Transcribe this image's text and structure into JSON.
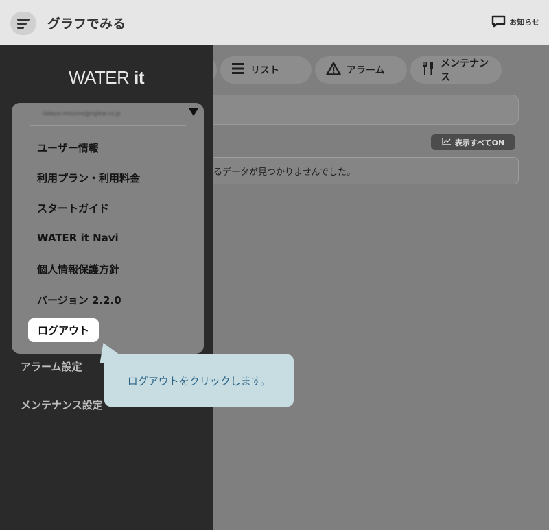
{
  "header": {
    "title": "グラフでみる",
    "notice_label": "お知らせ"
  },
  "tabs": [
    {
      "label": "リスト",
      "icon": "list-icon"
    },
    {
      "label": "アラーム",
      "icon": "warning-icon"
    },
    {
      "label": "メンテナンス",
      "icon": "tools-icon"
    }
  ],
  "main": {
    "show_all_label": "表示すべてON",
    "empty_message": "るデータが見つかりませんでした。"
  },
  "drawer": {
    "logo": {
      "light": "WATER ",
      "bold": "it"
    },
    "items": [
      {
        "label": "アラーム設定"
      },
      {
        "label": "メンテナンス設定"
      }
    ]
  },
  "dropdown": {
    "email": "takeyo.mizumo@ngikw.co.jp",
    "items": [
      {
        "label": "ユーザー情報"
      },
      {
        "label": "利用プラン・利用料金"
      },
      {
        "label": "スタートガイド"
      },
      {
        "label": "WATER it Navi"
      },
      {
        "label": "個人情報保護方針"
      },
      {
        "label": "バージョン 2.2.0"
      }
    ],
    "logout_label": "ログアウト"
  },
  "tooltip": {
    "text": "ログアウトをクリックします。"
  },
  "colors": {
    "drawer_bg": "#2a2a2a",
    "tooltip_bg": "#c7dde2",
    "tooltip_text": "#2d6486"
  }
}
